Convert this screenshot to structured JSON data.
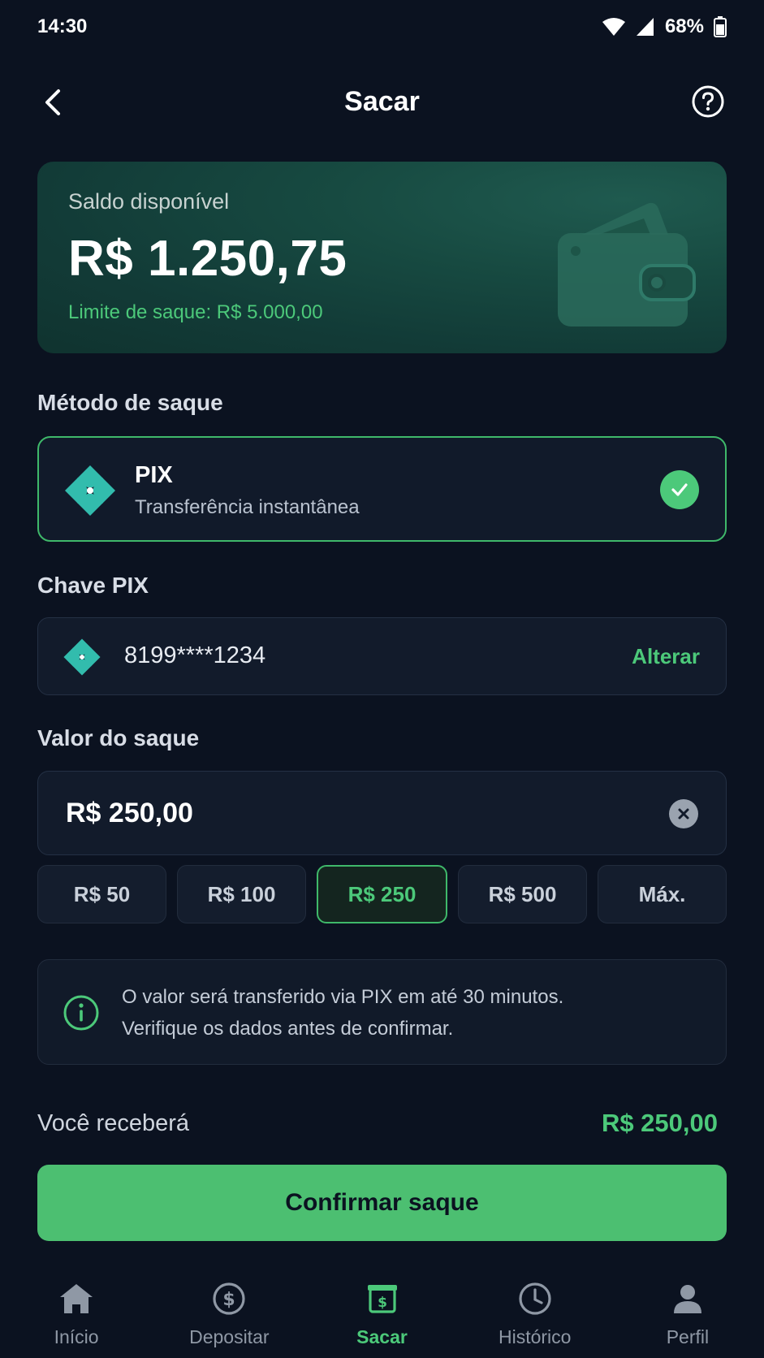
{
  "status_bar": {
    "time": "14:30",
    "battery": "68%"
  },
  "header": {
    "title": "Sacar"
  },
  "balance": {
    "label": "Saldo disponível",
    "amount": "R$ 1.250,75",
    "limit": "Limite de saque: R$ 5.000,00"
  },
  "method": {
    "section_title": "Método de saque",
    "name": "PIX",
    "description": "Transferência instantânea"
  },
  "pix_key": {
    "section_title": "Chave PIX",
    "value": "8199****1234",
    "change_label": "Alterar"
  },
  "amount": {
    "section_title": "Valor do saque",
    "value": "R$ 250,00",
    "chips": [
      "R$ 50",
      "R$ 100",
      "R$ 250",
      "R$ 500",
      "Máx."
    ],
    "selected_chip": "R$ 250"
  },
  "info": {
    "line1": "O valor será transferido via PIX em até 30 minutos.",
    "line2": "Verifique os dados antes de confirmar."
  },
  "summary": {
    "label": "Você receberá",
    "value": "R$ 250,00"
  },
  "confirm_label": "Confirmar saque",
  "nav": {
    "items": [
      {
        "label": "Início",
        "icon": "home-icon"
      },
      {
        "label": "Depositar",
        "icon": "dollar-circle-icon"
      },
      {
        "label": "Sacar",
        "icon": "withdraw-icon"
      },
      {
        "label": "Histórico",
        "icon": "clock-icon"
      },
      {
        "label": "Perfil",
        "icon": "user-icon"
      }
    ],
    "active": "Sacar"
  },
  "colors": {
    "background": "#0b1220",
    "accent": "#4cc97a",
    "card": "#121b2b",
    "pix": "#32bcad"
  }
}
